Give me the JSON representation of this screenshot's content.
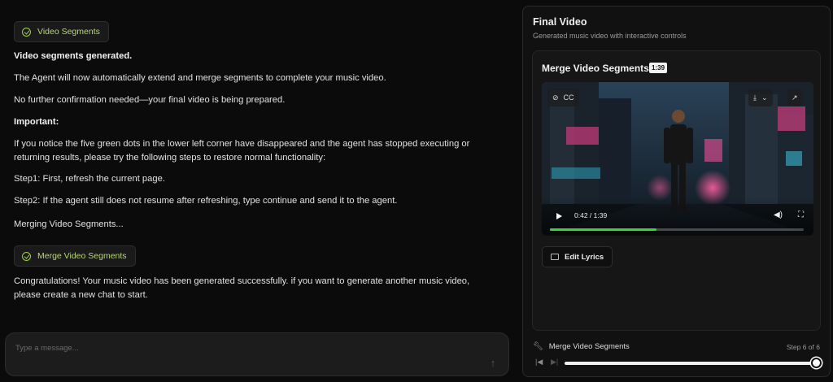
{
  "chat": {
    "badge_segments": "Video Segments",
    "lines": [
      "Video segments generated.",
      "The Agent will now automatically extend and merge segments to complete your music video.",
      "No further confirmation needed—your final video is being prepared.",
      "Important:",
      "If you notice the five green dots in the lower left corner have disappeared and the agent has stopped executing or returning results, please try the following steps to restore normal functionality:",
      "Step1: First, refresh the current page.",
      "Step2: If the agent still does not resume after refreshing, type continue and send it to the agent.",
      "Merging Video Segments...",
      "Congratulations! Your music video has been generated successfully. if you want to generate another music video, please create a new chat to start."
    ],
    "badge_merge": "Merge Video Segments",
    "input_placeholder": "Type a message..."
  },
  "panel": {
    "title": "Final Video",
    "subtitle": "Generated music video with interactive controls",
    "card_title": "Merge Video Segments",
    "duration_badge": "1:39",
    "video": {
      "cc_label": "CC",
      "time": "0:42 / 1:39",
      "progress_fraction": 0.42
    },
    "edit_lyrics": "Edit Lyrics",
    "footer": {
      "step_name": "Merge Video Segments",
      "step_count": "Step 6 of 6"
    }
  },
  "colors": {
    "accent_green": "#9dd23a",
    "progress_green": "#3ad33a"
  }
}
